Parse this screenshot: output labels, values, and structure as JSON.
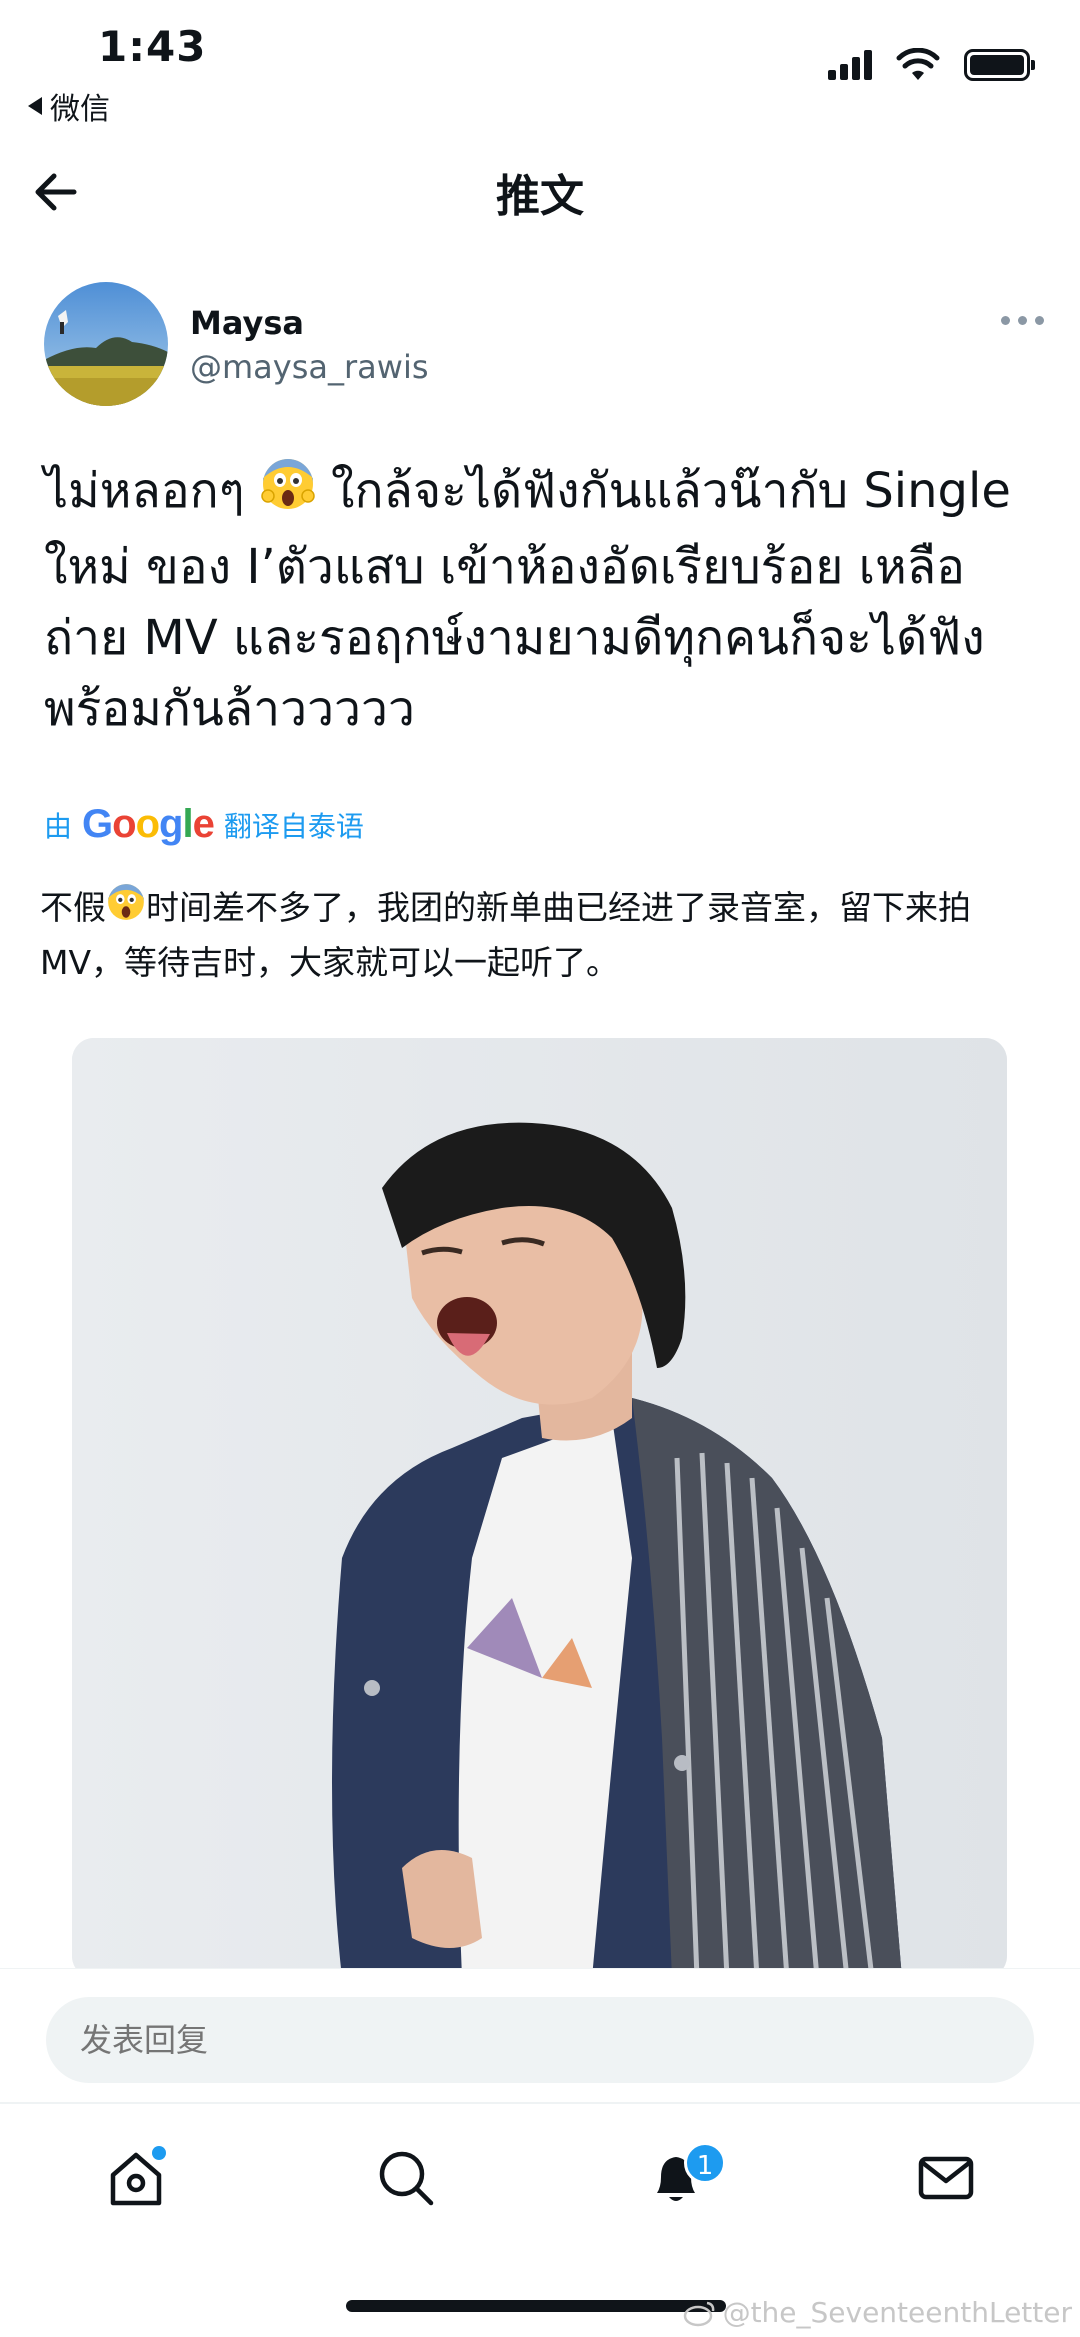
{
  "status_bar": {
    "time": "1:43",
    "back_app": "微信"
  },
  "header": {
    "title": "推文"
  },
  "tweet": {
    "author_name": "Maysa",
    "author_handle": "@maysa_rawis",
    "text_part1": "ไม่หลอกๆ ",
    "emoji": "😱",
    "text_part2": " ใกล้จะได้ฟังกันแล้วน๊ากับ Single ใหม่ ของ I’ตัวแสบ เข้าห้องอัดเรียบร้อย เหลือถ่าย MV และรอฤกษ์งามยามดีทุกคนก็จะได้ฟังพร้อมกันล้าววววว",
    "translated_prefix": "由",
    "translated_brand": "Google",
    "translated_suffix": "翻译自泰语",
    "translation_part1": "不假",
    "translation_part2": "时间差不多了，我团的新单曲已经进了录音室，留下来拍MV，等待吉时，大家就可以一起听了。"
  },
  "reply": {
    "placeholder": "发表回复"
  },
  "tab_bar": {
    "items": [
      {
        "name": "home",
        "icon": "home-icon",
        "has_dot": true
      },
      {
        "name": "search",
        "icon": "search-icon"
      },
      {
        "name": "notifications",
        "icon": "bell-icon",
        "badge": "1"
      },
      {
        "name": "messages",
        "icon": "mail-icon"
      }
    ]
  },
  "watermark": "@the_SeventeenthLetter",
  "colors": {
    "accent": "#1d9bf0",
    "text": "#0f1419",
    "secondary_text": "#536471"
  }
}
